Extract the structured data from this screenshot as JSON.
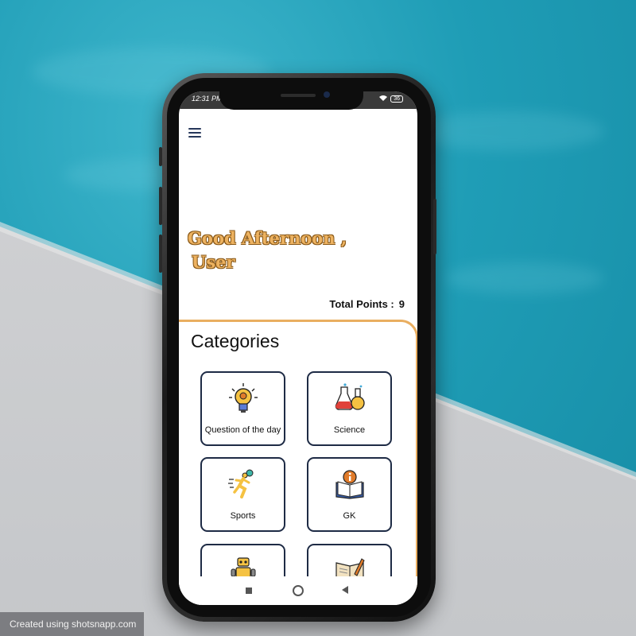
{
  "status_bar": {
    "time": "12:31 PM | ",
    "battery": "36"
  },
  "greeting": {
    "line1": "Good Afternoon ,",
    "line2": "User"
  },
  "points": {
    "label": "Total Points :",
    "value": "9"
  },
  "categories": {
    "title": "Categories",
    "items": [
      {
        "label": "Question of the day",
        "icon": "lightbulb-icon"
      },
      {
        "label": "Science",
        "icon": "flask-icon"
      },
      {
        "label": "Sports",
        "icon": "running-person-icon"
      },
      {
        "label": "GK",
        "icon": "info-book-icon"
      },
      {
        "label": "",
        "icon": "robot-icon"
      },
      {
        "label": "",
        "icon": "writing-book-icon"
      }
    ]
  },
  "watermark": "Created using shotsnapp.com",
  "colors": {
    "accent": "#e9ae60",
    "tile_border": "#1e2b45",
    "greeting": "#edb260"
  }
}
